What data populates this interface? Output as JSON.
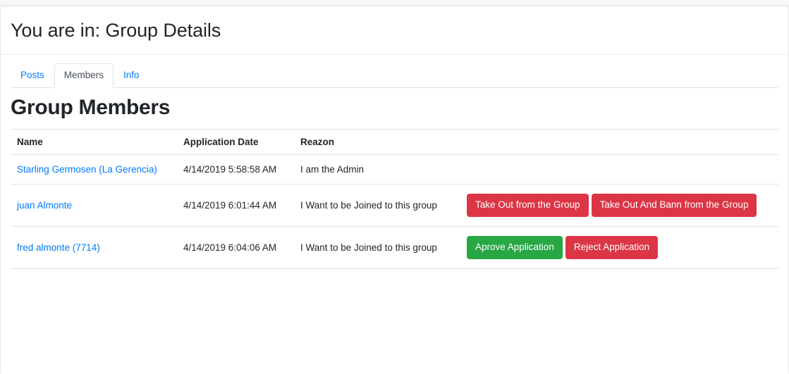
{
  "page": {
    "title": "You are in: Group Details",
    "section_heading": "Group Members"
  },
  "tabs": [
    {
      "label": "Posts",
      "active": false
    },
    {
      "label": "Members",
      "active": true
    },
    {
      "label": "Info",
      "active": false
    }
  ],
  "table": {
    "columns": [
      "Name",
      "Application Date",
      "Reazon",
      ""
    ],
    "rows": [
      {
        "name": "Starling Germosen (La Gerencia)",
        "date": "4/14/2019 5:58:58 AM",
        "reason": "I am the Admin",
        "actions": []
      },
      {
        "name": "juan Almonte",
        "date": "4/14/2019 6:01:44 AM",
        "reason": "I Want to be Joined to this group",
        "actions": [
          {
            "label": "Take Out from the Group",
            "style": "danger"
          },
          {
            "label": "Take Out And Bann from the Group",
            "style": "danger"
          }
        ]
      },
      {
        "name": "fred almonte (7714)",
        "date": "4/14/2019 6:04:06 AM",
        "reason": "I Want to be Joined to this group",
        "actions": [
          {
            "label": "Aprove Application",
            "style": "success"
          },
          {
            "label": "Reject Application",
            "style": "danger"
          }
        ]
      }
    ]
  },
  "colors": {
    "link": "#007bff",
    "danger": "#dc3545",
    "success": "#28a745",
    "border": "#dee2e6",
    "text": "#212529"
  }
}
